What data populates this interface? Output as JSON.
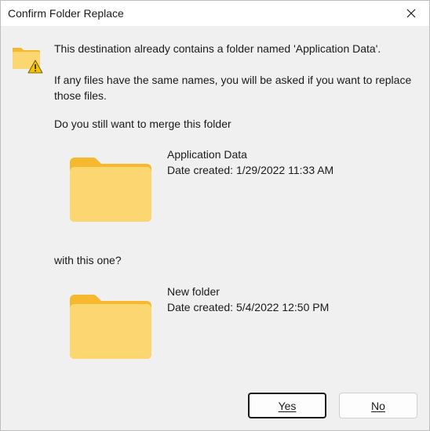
{
  "window": {
    "title": "Confirm Folder Replace"
  },
  "message": {
    "line1": "This destination already contains a folder named 'Application Data'.",
    "line2": "If any files have the same names, you will be asked if you want to replace those files.",
    "line3": "Do you still want to merge this folder",
    "line4": "with this one?"
  },
  "existing_folder": {
    "name": "Application Data",
    "created": "Date created: 1/29/2022 11:33 AM"
  },
  "new_folder": {
    "name": "New folder",
    "created": "Date created: 5/4/2022 12:50 PM"
  },
  "buttons": {
    "yes_label": "Yes",
    "no_label": "No"
  },
  "icons": {
    "close": "close-icon",
    "warning_folder": "folder-warning-icon",
    "folder": "folder-icon"
  },
  "colors": {
    "folder_front": "#fcd671",
    "folder_back": "#f5b82e",
    "warning": "#f2c200"
  }
}
